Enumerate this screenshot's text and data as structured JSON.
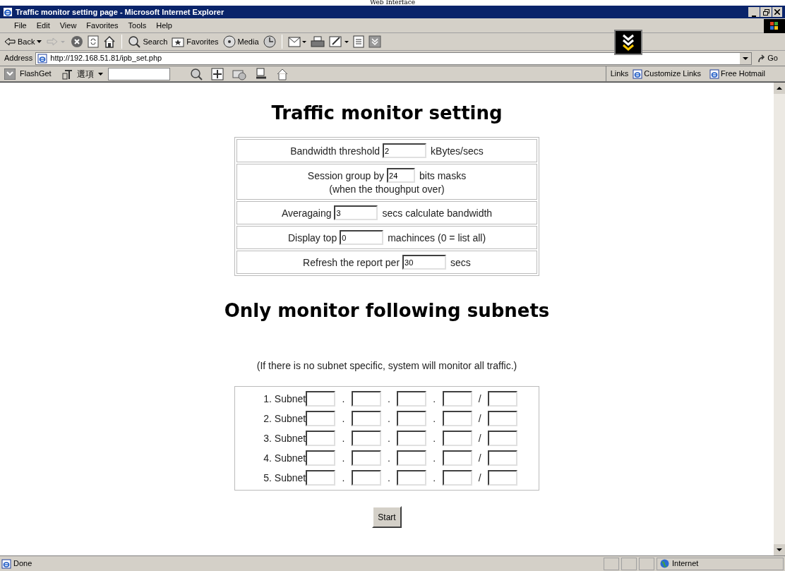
{
  "caption": "Web Interface",
  "window": {
    "title": "Traffic monitor setting page - Microsoft Internet Explorer"
  },
  "menu": [
    "File",
    "Edit",
    "View",
    "Favorites",
    "Tools",
    "Help"
  ],
  "toolbar": [
    {
      "kind": "back",
      "label": "Back"
    },
    {
      "kind": "forward"
    },
    {
      "kind": "stop"
    },
    {
      "kind": "refresh"
    },
    {
      "kind": "home"
    },
    {
      "kind": "sep"
    },
    {
      "kind": "search",
      "label": "Search"
    },
    {
      "kind": "favorites",
      "label": "Favorites"
    },
    {
      "kind": "media",
      "label": "Media"
    },
    {
      "kind": "history"
    },
    {
      "kind": "sep"
    },
    {
      "kind": "mail"
    },
    {
      "kind": "print"
    },
    {
      "kind": "edit"
    },
    {
      "kind": "doc"
    },
    {
      "kind": "messenger"
    }
  ],
  "address": {
    "label": "Address",
    "url": "http://192.168.51.81/ipb_set.php",
    "go": "Go"
  },
  "links_bar": {
    "flashget": "FlashGet",
    "options": "選項",
    "links": "Links",
    "items": [
      "Customize Links",
      "Free Hotmail"
    ]
  },
  "page": {
    "title": "Traffic monitor setting",
    "settings": [
      {
        "before": "Bandwidth threshold",
        "value": "2",
        "after": "kBytes/secs"
      },
      {
        "before": "Session group by",
        "value": "24",
        "after": "bits masks",
        "note": "(when the thoughput over)"
      },
      {
        "before": "Averagaing",
        "value": "3",
        "after": "secs calculate bandwidth"
      },
      {
        "before": "Display top",
        "value": "0",
        "after": "machinces (0 = list all)"
      },
      {
        "before": "Refresh the report per",
        "value": "30",
        "after": "secs"
      }
    ],
    "subnets_title": "Only monitor following subnets",
    "subnets_note": "(If there is no subnet specific, system will monitor all traffic.)",
    "subnets": [
      {
        "label": "1. Subnet",
        "separators": [
          ".",
          ".",
          ".",
          "/"
        ]
      },
      {
        "label": "2. Subnet",
        "separators": [
          ".",
          ".",
          ".",
          "/"
        ]
      },
      {
        "label": "3. Subnet",
        "separators": [
          ".",
          ".",
          ".",
          "/"
        ]
      },
      {
        "label": "4. Subnet",
        "separators": [
          ".",
          ".",
          ".",
          "/"
        ]
      },
      {
        "label": "5. Subnet",
        "separators": [
          ".",
          ".",
          ".",
          "/"
        ]
      }
    ],
    "submit": "Start"
  },
  "status_bar": {
    "text": "Done",
    "zone": "Internet"
  }
}
